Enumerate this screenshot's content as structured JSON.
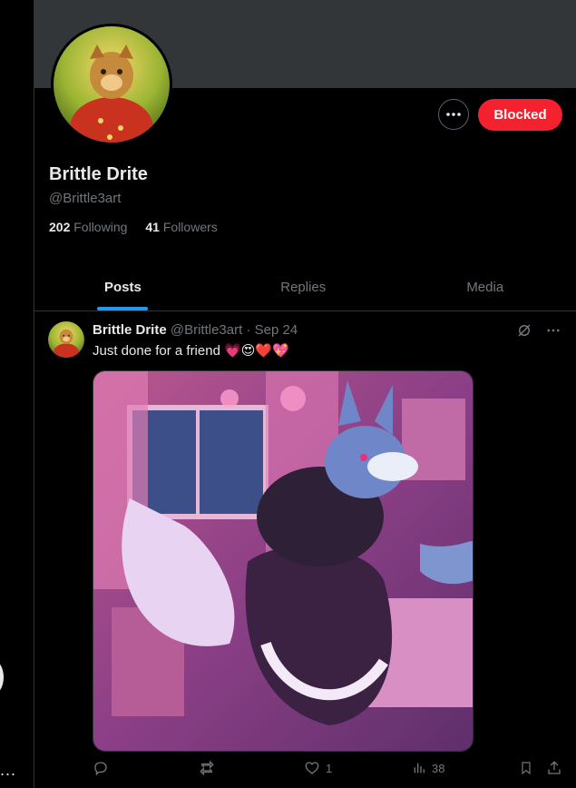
{
  "profile": {
    "display_name": "Brittle Drite",
    "handle": "@Brittle3art",
    "following_count": "202",
    "following_label": "Following",
    "followers_count": "41",
    "followers_label": "Followers",
    "more_icon": "ellipsis-icon",
    "blocked_label": "Blocked"
  },
  "tabs": [
    {
      "label": "Posts",
      "active": true
    },
    {
      "label": "Replies",
      "active": false
    },
    {
      "label": "Media",
      "active": false
    }
  ],
  "post": {
    "author_name": "Brittle Drite",
    "author_handle": "@Brittle3art",
    "separator": "·",
    "date": "Sep 24",
    "text": "Just done for a friend 💗😍❤️💖",
    "actions": {
      "reply_count": "",
      "repost_count": "",
      "like_count": "1",
      "views_count": "38"
    }
  },
  "left_rail": {
    "more_text": "..."
  },
  "colors": {
    "background": "#000000",
    "banner": "#333639",
    "accent": "#1d9bf0",
    "blocked": "#f4212e",
    "muted_text": "#71767b",
    "border": "#2f3336"
  }
}
